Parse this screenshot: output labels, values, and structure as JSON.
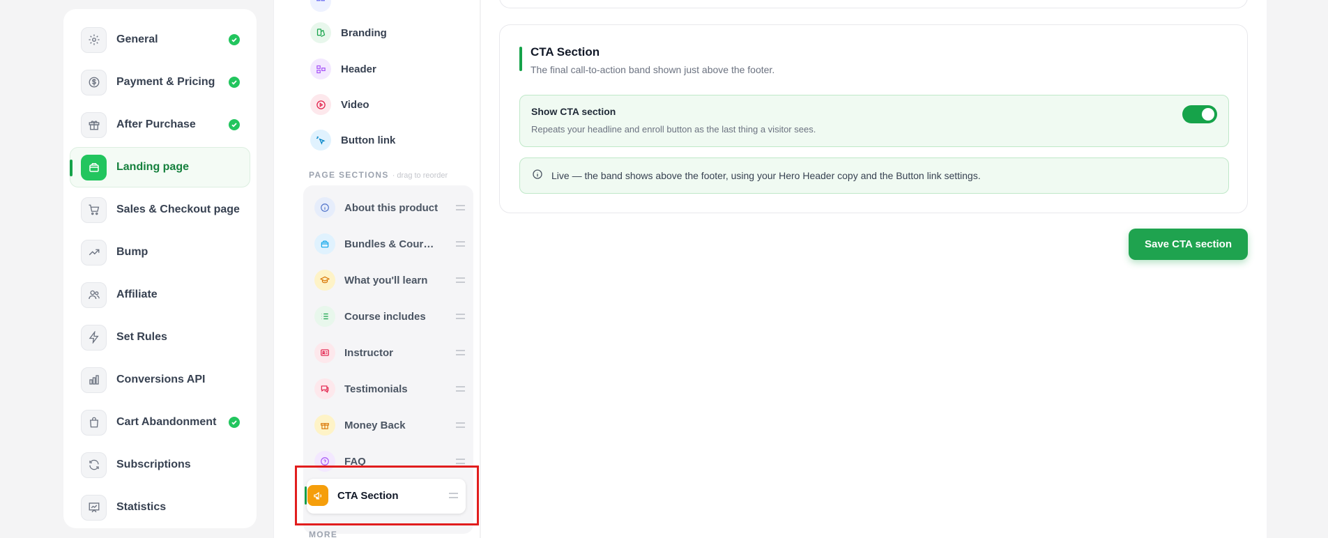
{
  "nav": {
    "items": [
      {
        "label": "General",
        "icon": "gear-icon",
        "done": true
      },
      {
        "label": "Payment & Pricing",
        "icon": "dollar-icon",
        "done": true
      },
      {
        "label": "After Purchase",
        "icon": "gift-icon",
        "done": true
      },
      {
        "label": "Landing page",
        "icon": "browser-icon",
        "done": false,
        "active": true
      },
      {
        "label": "Sales & Checkout page",
        "icon": "cart-icon",
        "done": false
      },
      {
        "label": "Bump",
        "icon": "trend-up-icon",
        "done": false
      },
      {
        "label": "Affiliate",
        "icon": "users-icon",
        "done": false
      },
      {
        "label": "Set Rules",
        "icon": "bolt-icon",
        "done": false
      },
      {
        "label": "Conversions API",
        "icon": "bar-chart-icon",
        "done": false
      },
      {
        "label": "Cart Abandonment",
        "icon": "bag-icon",
        "done": true
      },
      {
        "label": "Subscriptions",
        "icon": "refresh-icon",
        "done": false
      },
      {
        "label": "Statistics",
        "icon": "presentation-chart-icon",
        "done": false
      }
    ]
  },
  "blocks": {
    "items": [
      {
        "label": "Branding",
        "icon": "palette-icon"
      },
      {
        "label": "Header",
        "icon": "layout-icon"
      },
      {
        "label": "Video",
        "icon": "play-icon"
      },
      {
        "label": "Button link",
        "icon": "pointer-icon"
      }
    ]
  },
  "sections": {
    "title": "PAGE SECTIONS",
    "hint": "· drag to reorder",
    "items": [
      {
        "label": "About this product",
        "icon": "info-icon"
      },
      {
        "label": "Bundles & Courses",
        "icon": "box-icon"
      },
      {
        "label": "What you'll learn",
        "icon": "graduation-cap-icon"
      },
      {
        "label": "Course includes",
        "icon": "list-icon"
      },
      {
        "label": "Instructor",
        "icon": "id-card-icon"
      },
      {
        "label": "Testimonials",
        "icon": "chat-icon"
      },
      {
        "label": "Money Back",
        "icon": "gift-icon"
      },
      {
        "label": "FAQ",
        "icon": "question-icon"
      },
      {
        "label": "CTA Section",
        "icon": "megaphone-icon",
        "active": true
      }
    ],
    "more_title": "MORE"
  },
  "main": {
    "title": "CTA Section",
    "subtitle": "The final call-to-action band shown just above the footer.",
    "toggle": {
      "title": "Show CTA section",
      "description": "Repeats your headline and enroll button as the last thing a visitor sees.",
      "on": true
    },
    "info": "Live — the band shows above the footer, using your Hero Header copy and the Button link settings.",
    "save_label": "Save CTA section"
  },
  "colors": {
    "accent": "#16a34a",
    "highlight": "#e11d1d"
  }
}
